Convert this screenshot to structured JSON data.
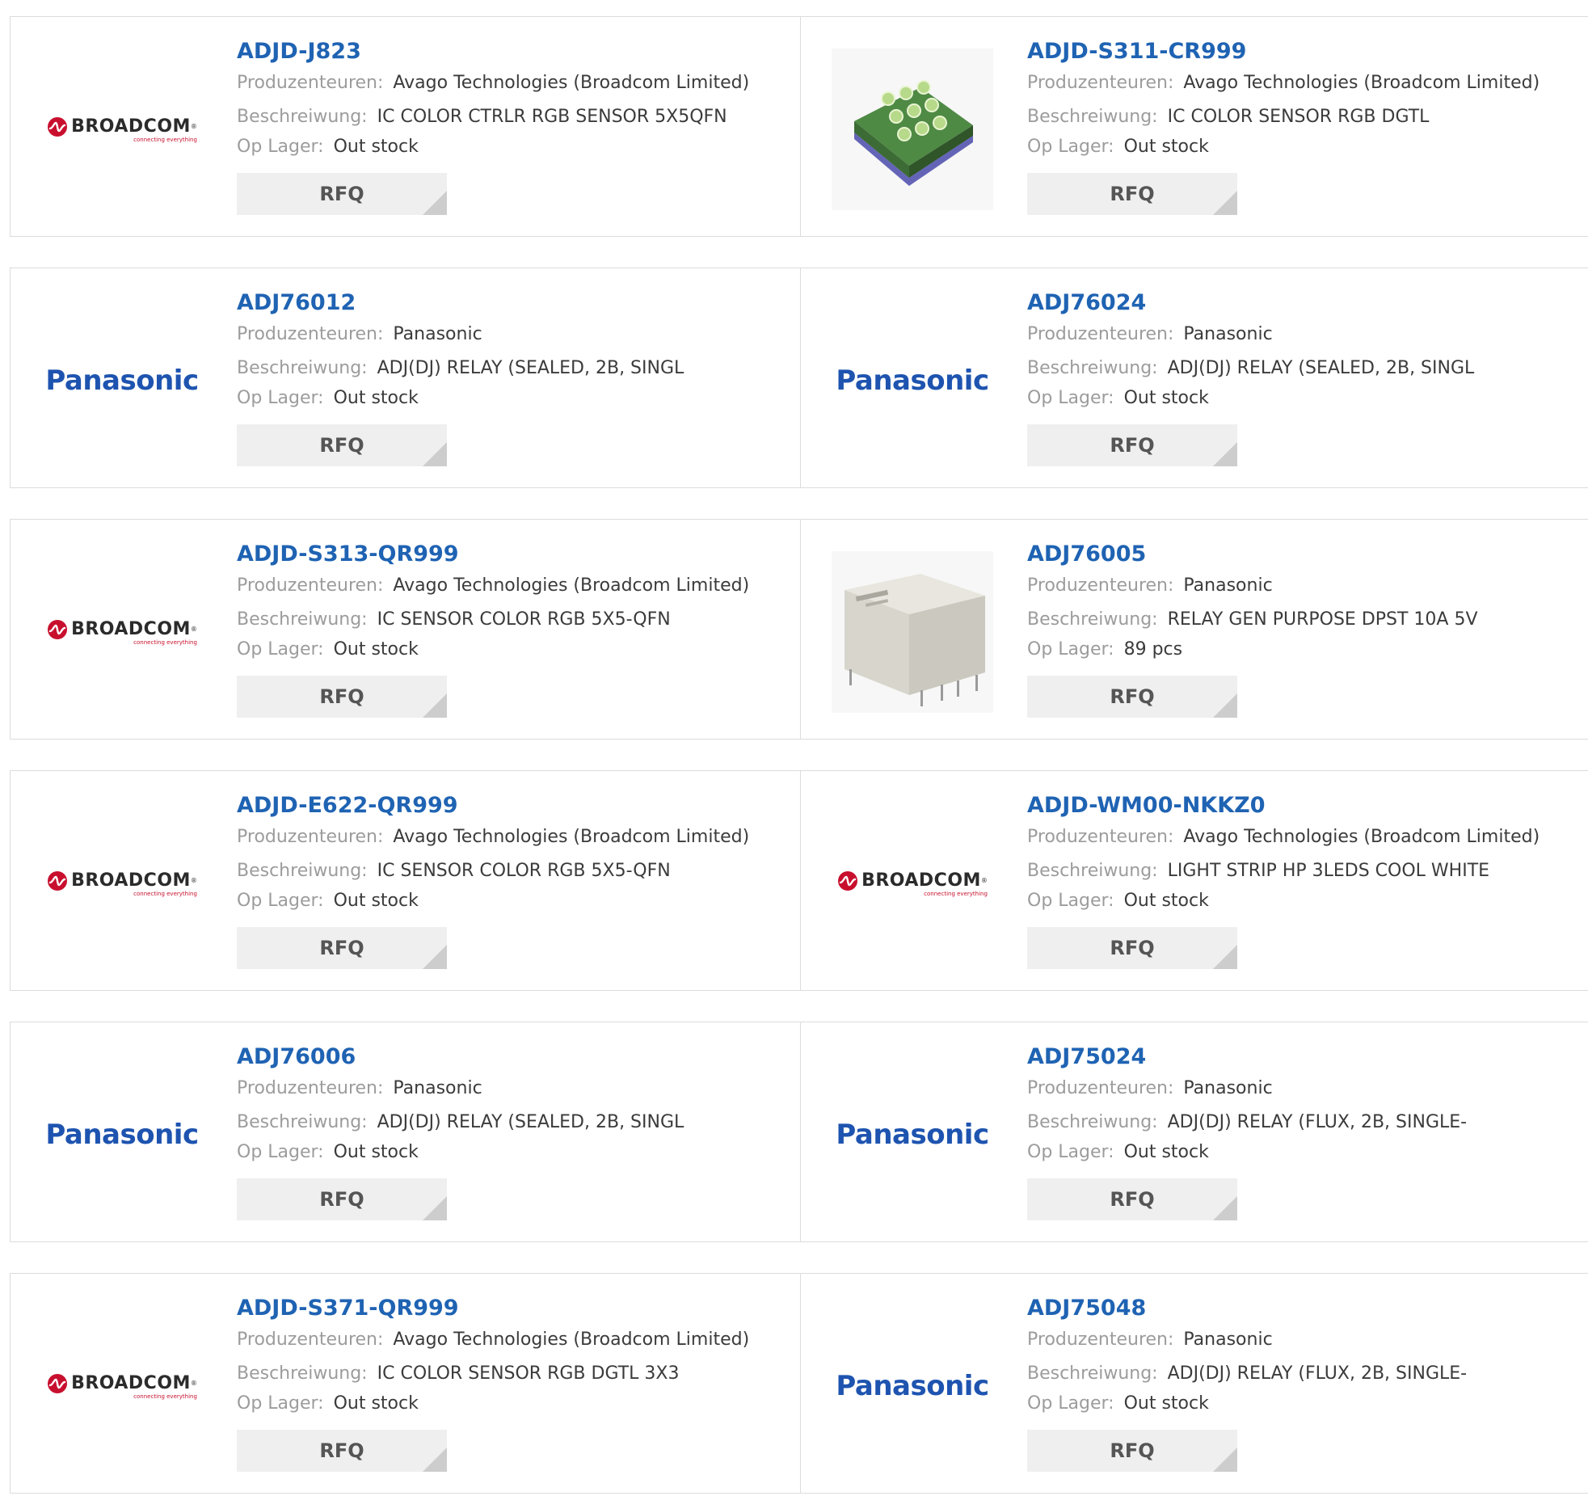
{
  "labels": {
    "manufacturer": "Produzenteuren:",
    "description": "Beschreiwung:",
    "stock": "Op Lager:",
    "rfq": "RFQ"
  },
  "logos": {
    "broadcom": {
      "word": "BROADCOM",
      "tag": "connecting everything",
      "registered": "®"
    },
    "panasonic": {
      "word": "Panasonic"
    }
  },
  "colors": {
    "link": "#1f63b3",
    "panasonic": "#1e54b0",
    "broadcom_red": "#c8102e"
  },
  "products": [
    {
      "part": "ADJD-J823",
      "manufacturer": "Avago Technologies (Broadcom Limited)",
      "description": "IC COLOR CTRLR RGB SENSOR 5X5QFN",
      "stock": "Out stock",
      "image": "broadcom-logo"
    },
    {
      "part": "ADJD-S311-CR999",
      "manufacturer": "Avago Technologies (Broadcom Limited)",
      "description": "IC COLOR SENSOR RGB DGTL",
      "stock": "Out stock",
      "image": "chip-photo"
    },
    {
      "part": "ADJ76012",
      "manufacturer": "Panasonic",
      "description": "ADJ(DJ) RELAY (SEALED, 2B, SINGL",
      "stock": "Out stock",
      "image": "panasonic-logo"
    },
    {
      "part": "ADJ76024",
      "manufacturer": "Panasonic",
      "description": "ADJ(DJ) RELAY (SEALED, 2B, SINGL",
      "stock": "Out stock",
      "image": "panasonic-logo"
    },
    {
      "part": "ADJD-S313-QR999",
      "manufacturer": "Avago Technologies (Broadcom Limited)",
      "description": "IC SENSOR COLOR RGB 5X5-QFN",
      "stock": "Out stock",
      "image": "broadcom-logo"
    },
    {
      "part": "ADJ76005",
      "manufacturer": "Panasonic",
      "description": "RELAY GEN PURPOSE DPST 10A 5V",
      "stock": "89 pcs",
      "image": "relay-photo"
    },
    {
      "part": "ADJD-E622-QR999",
      "manufacturer": "Avago Technologies (Broadcom Limited)",
      "description": "IC SENSOR COLOR RGB 5X5-QFN",
      "stock": "Out stock",
      "image": "broadcom-logo"
    },
    {
      "part": "ADJD-WM00-NKKZ0",
      "manufacturer": "Avago Technologies (Broadcom Limited)",
      "description": "LIGHT STRIP HP 3LEDS COOL WHITE",
      "stock": "Out stock",
      "image": "broadcom-logo"
    },
    {
      "part": "ADJ76006",
      "manufacturer": "Panasonic",
      "description": "ADJ(DJ) RELAY (SEALED, 2B, SINGL",
      "stock": "Out stock",
      "image": "panasonic-logo"
    },
    {
      "part": "ADJ75024",
      "manufacturer": "Panasonic",
      "description": "ADJ(DJ) RELAY (FLUX, 2B, SINGLE-",
      "stock": "Out stock",
      "image": "panasonic-logo"
    },
    {
      "part": "ADJD-S371-QR999",
      "manufacturer": "Avago Technologies (Broadcom Limited)",
      "description": "IC COLOR SENSOR RGB DGTL 3X3",
      "stock": "Out stock",
      "image": "broadcom-logo"
    },
    {
      "part": "ADJ75048",
      "manufacturer": "Panasonic",
      "description": "ADJ(DJ) RELAY (FLUX, 2B, SINGLE-",
      "stock": "Out stock",
      "image": "panasonic-logo"
    }
  ]
}
